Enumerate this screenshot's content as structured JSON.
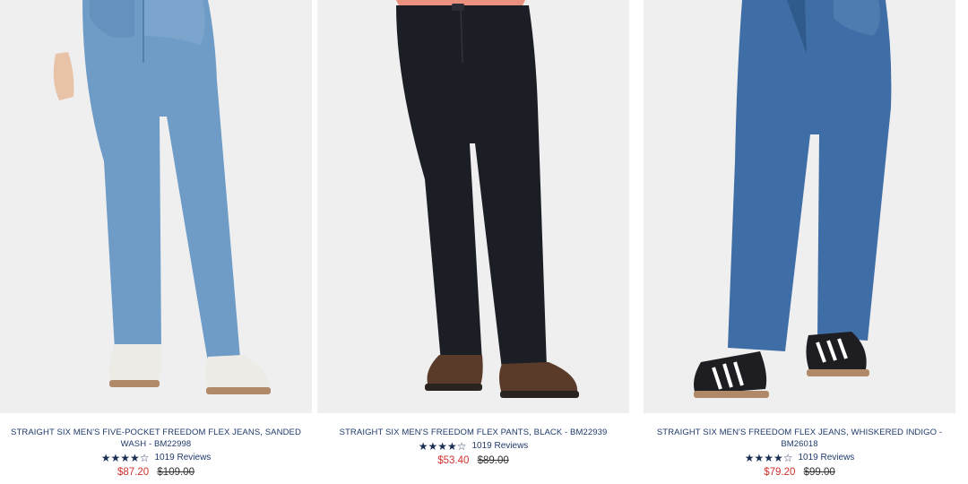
{
  "products": [
    {
      "title": "STRAIGHT SIX MEN'S FIVE-POCKET FREEDOM FLEX JEANS, SANDED WASH - BM22998",
      "rating_stars": "★★★★☆",
      "reviews": "1019 Reviews",
      "sale_price": "$87.20",
      "original_price": "$109.00",
      "denim_color": "#6f9cc6",
      "shoe_color": "#ecebe5"
    },
    {
      "title": "STRAIGHT SIX MEN'S FREEDOM FLEX PANTS, BLACK - BM22939",
      "rating_stars": "★★★★☆",
      "reviews": "1019 Reviews",
      "sale_price": "$53.40",
      "original_price": "$89.00",
      "denim_color": "#1c1e26",
      "shoe_color": "#5a3a28"
    },
    {
      "title": "STRAIGHT SIX MEN'S FREEDOM FLEX JEANS, WHISKERED INDIGO - BM26018",
      "rating_stars": "★★★★☆",
      "reviews": "1019 Reviews",
      "sale_price": "$79.20",
      "original_price": "$99.00",
      "denim_color": "#3f6ea6",
      "shoe_color": "#1e1e22"
    }
  ],
  "colors": {
    "title": "#1f3a6b",
    "sale": "#d0312d",
    "photo_bg": "#efeff0"
  }
}
